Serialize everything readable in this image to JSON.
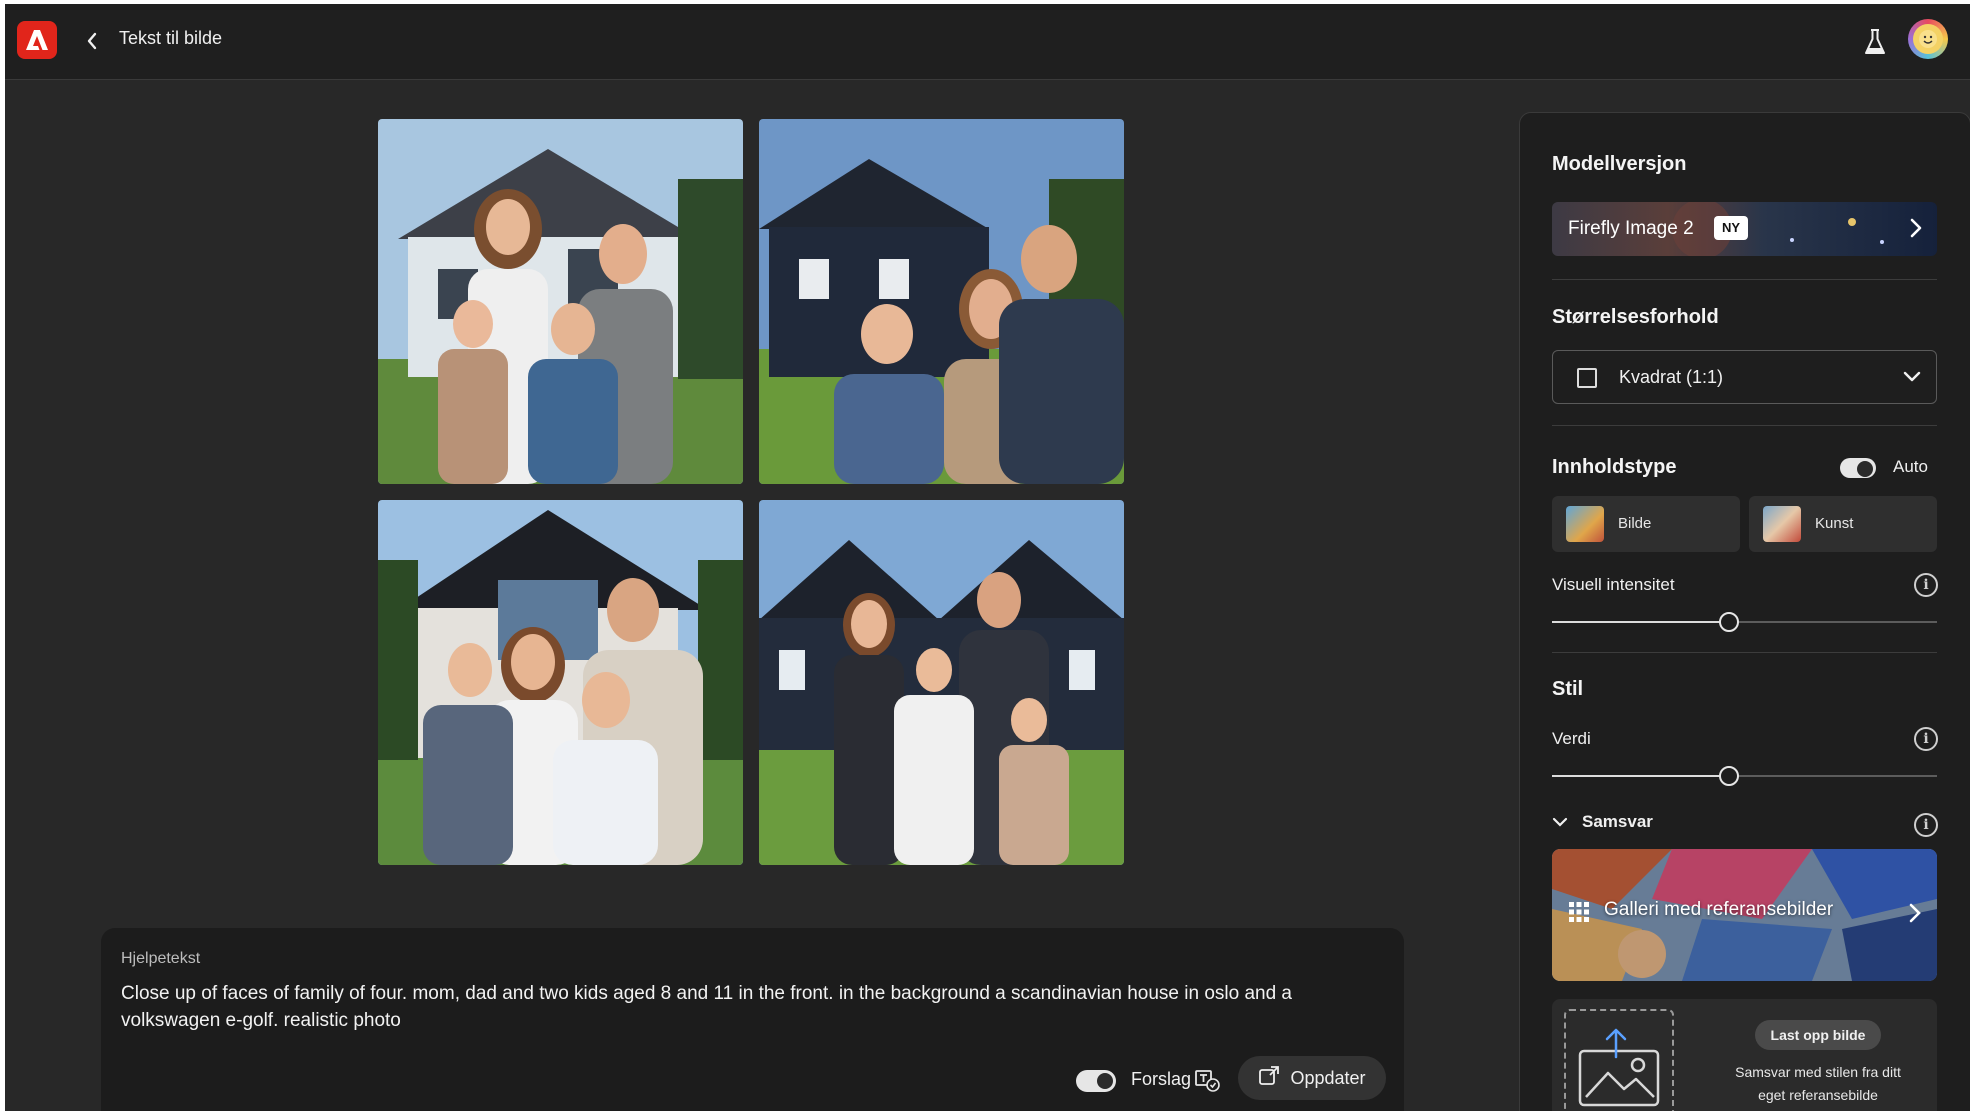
{
  "header": {
    "title": "Tekst til bilde",
    "back_icon": "chevron-left-icon",
    "labs_icon": "flask-icon",
    "avatar_icon": "avatar"
  },
  "images": [
    {
      "label": "generated-image-1"
    },
    {
      "label": "generated-image-2"
    },
    {
      "label": "generated-image-3"
    },
    {
      "label": "generated-image-4"
    }
  ],
  "prompt": {
    "label": "Hjelpetekst",
    "text": "Close up of faces of family of four. mom, dad and two kids aged 8 and 11 in the front. in the background a scandinavian house in oslo and a volkswagen e-golf. realistic photo",
    "suggest_label": "Forslag",
    "suggest_on": true,
    "update_label": "Oppdater"
  },
  "panel": {
    "model_heading": "Modellversjon",
    "model_name": "Firefly Image 2",
    "model_badge": "NY",
    "aspect_heading": "Størrelsesforhold",
    "aspect_value": "Kvadrat (1:1)",
    "content_heading": "Innholdstype",
    "content_auto_label": "Auto",
    "content_auto_on": true,
    "content_types": [
      {
        "label": "Bilde"
      },
      {
        "label": "Kunst"
      }
    ],
    "intensity_label": "Visuell intensitet",
    "intensity_value": 0.46,
    "style_heading": "Stil",
    "strength_label": "Verdi",
    "strength_value": 0.46,
    "match_label": "Samsvar",
    "gallery_label": "Galleri med referansebilder",
    "upload_button": "Last opp bilde",
    "upload_desc": "Samsvar med stilen fra ditt eget referansebilde"
  },
  "colors": {
    "accent_brand": "#e1251b",
    "background": "#282828",
    "panel": "#1e1e1e"
  }
}
